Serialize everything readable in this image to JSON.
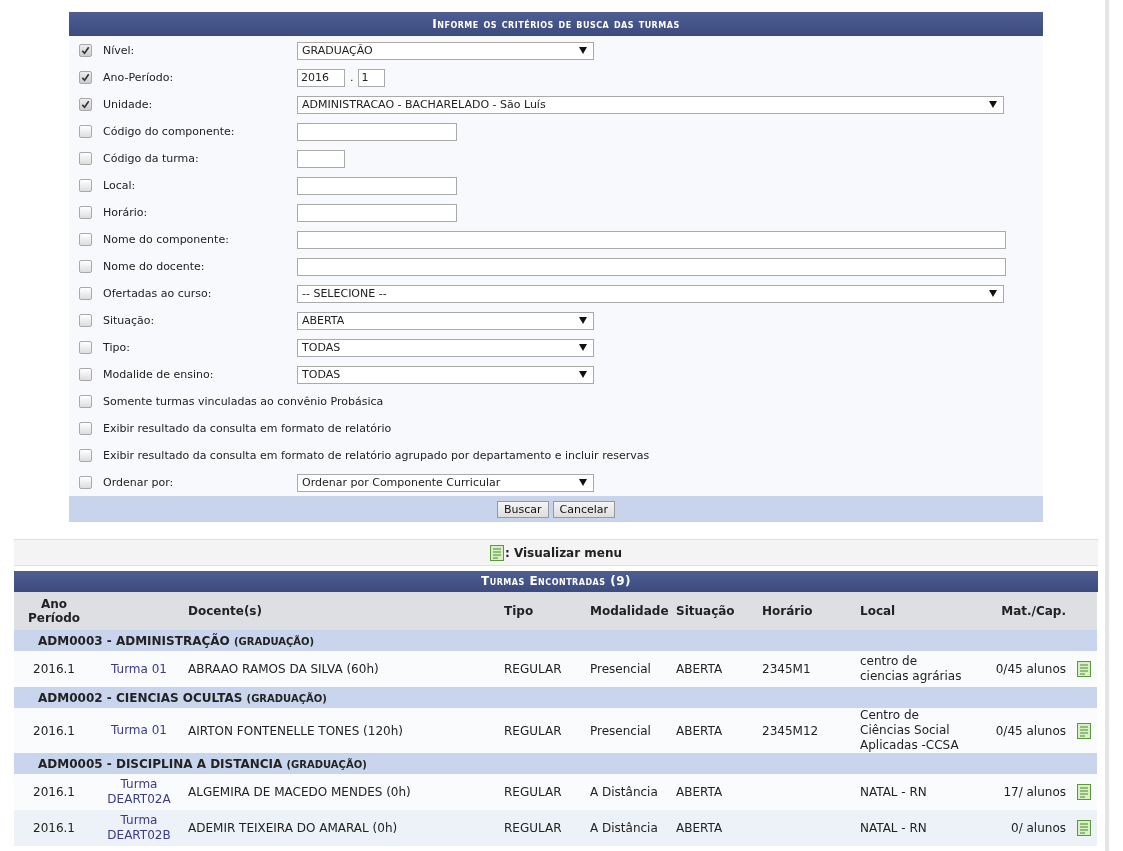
{
  "search_form": {
    "title": "Informe os critérios de busca das turmas",
    "fields": [
      {
        "kind": "select",
        "checked": true,
        "label": "Nível:",
        "value": "GRADUAÇÃO"
      },
      {
        "kind": "period",
        "checked": true,
        "label": "Ano-Período:",
        "year": "2016",
        "separator": ".",
        "period": "1"
      },
      {
        "kind": "select",
        "checked": true,
        "label": "Unidade:",
        "value": "ADMINISTRACAO - BACHARELADO - São Luís"
      },
      {
        "kind": "text",
        "checked": false,
        "label": "Código do componente:"
      },
      {
        "kind": "text",
        "checked": false,
        "label": "Código da turma:"
      },
      {
        "kind": "text",
        "checked": false,
        "label": "Local:"
      },
      {
        "kind": "text",
        "checked": false,
        "label": "Horário:"
      },
      {
        "kind": "text",
        "checked": false,
        "label": "Nome do componente:"
      },
      {
        "kind": "text",
        "checked": false,
        "label": "Nome do docente:"
      },
      {
        "kind": "select",
        "checked": false,
        "label": "Ofertadas ao curso:",
        "value": "-- SELECIONE --"
      },
      {
        "kind": "select",
        "checked": false,
        "label": "Situação:",
        "value": "ABERTA"
      },
      {
        "kind": "select",
        "checked": false,
        "label": "Tipo:",
        "value": "TODAS"
      },
      {
        "kind": "select",
        "checked": false,
        "label": "Modalide de ensino:",
        "value": "TODAS"
      },
      {
        "kind": "option",
        "checked": false,
        "label": "Somente turmas vinculadas ao convênio Probásica"
      },
      {
        "kind": "option",
        "checked": false,
        "label": "Exibir resultado da consulta em formato de relatório"
      },
      {
        "kind": "option",
        "checked": false,
        "label": "Exibir resultado da consulta em formato de relatório agrupado por departamento e incluir reservas"
      },
      {
        "kind": "select",
        "checked": false,
        "label": "Ordenar por:",
        "value": "Ordenar por Componente Curricular"
      }
    ],
    "buttons": [
      "Buscar",
      "Cancelar"
    ]
  },
  "menu_bar": {
    "label": ": Visualizar menu"
  },
  "results": {
    "title": "Turmas Encontradas (9)",
    "columns": [
      "Ano Período",
      "Docente(s)",
      "Tipo",
      "Modalidade",
      "Situação",
      "Horário",
      "Local",
      "Mat./Cap."
    ],
    "groups": [
      {
        "name": "ADM0003 - ADMINISTRAÇÃO",
        "level": "(GRADUAÇÃO)",
        "rows": [
          {
            "period": "2016.1",
            "class": "Turma 01",
            "teacher": "ABRAAO RAMOS DA SILVA (60h)",
            "type": "REGULAR",
            "modality": "Presencial",
            "status": "ABERTA",
            "schedule": "2345M1",
            "place": "centro de ciencias agrárias",
            "enrolled": "0/45 alunos"
          }
        ]
      },
      {
        "name": "ADM0002 - CIENCIAS OCULTAS",
        "level": "(GRADUAÇÃO)",
        "rows": [
          {
            "period": "2016.1",
            "class": "Turma 01",
            "teacher": "AIRTON FONTENELLE TONES (120h)",
            "type": "REGULAR",
            "modality": "Presencial",
            "status": "ABERTA",
            "schedule": "2345M12",
            "place": "Centro de Ciências Social Aplicadas -CCSA",
            "enrolled": "0/45 alunos"
          }
        ]
      },
      {
        "name": "ADM0005 - DISCIPLINA A DISTANCIA",
        "level": "(GRADUAÇÃO)",
        "rows": [
          {
            "period": "2016.1",
            "class": "Turma DEART02A",
            "teacher": "ALGEMIRA DE MACEDO MENDES (0h)",
            "type": "REGULAR",
            "modality": "A Distância",
            "status": "ABERTA",
            "place": "NATAL - RN",
            "enrolled": "17/ alunos"
          },
          {
            "period": "2016.1",
            "class": "Turma DEART02B",
            "teacher": "ADEMIR TEIXEIRA DO AMARAL (0h)",
            "type": "REGULAR",
            "modality": "A Distância",
            "status": "ABERTA",
            "place": "NATAL - RN",
            "enrolled": "0/ alunos"
          }
        ]
      }
    ]
  }
}
